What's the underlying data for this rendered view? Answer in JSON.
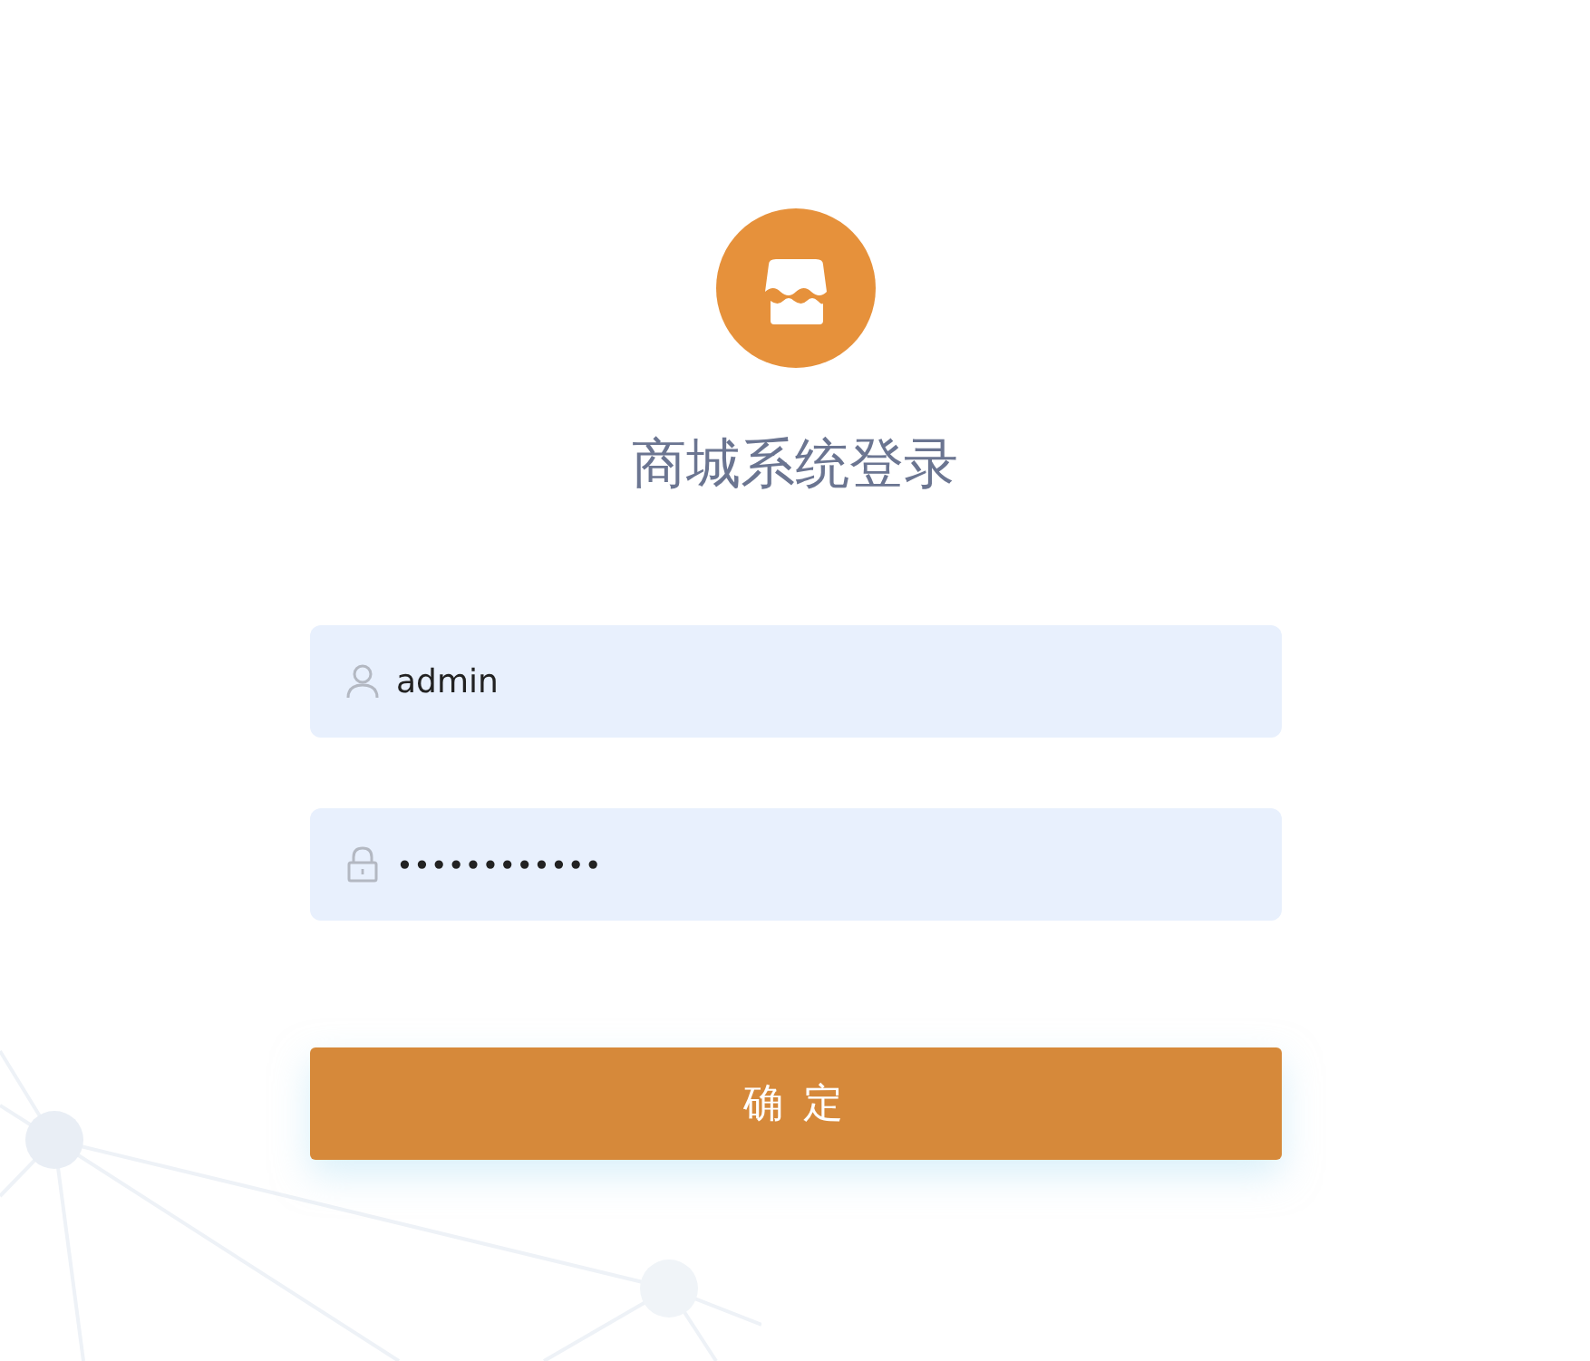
{
  "title": "商城系统登录",
  "fields": [
    {
      "kind": "user",
      "value": "admin"
    },
    {
      "kind": "password",
      "value": "••••••••••••"
    }
  ],
  "submit": {
    "label": "确 定"
  }
}
